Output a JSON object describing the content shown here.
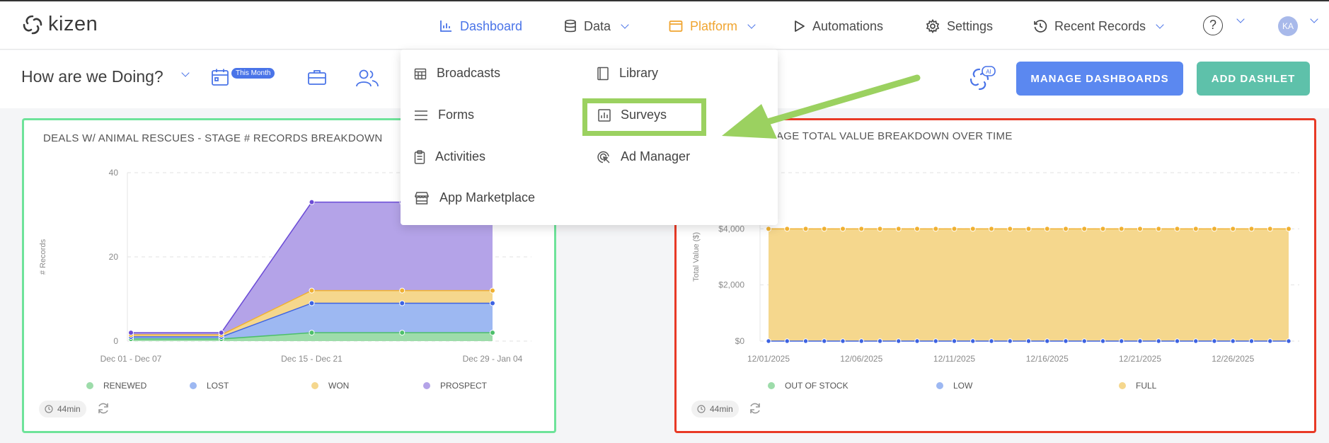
{
  "topbar": {
    "logo_text": "kizen",
    "nav": {
      "dashboard": "Dashboard",
      "data": "Data",
      "platform": "Platform",
      "automations": "Automations",
      "settings": "Settings",
      "recent_records": "Recent Records"
    },
    "help": "?",
    "avatar": "KA"
  },
  "subbar": {
    "title": "How are we Doing?",
    "badge": "This Month",
    "manage_label": "MANAGE DASHBOARDS",
    "add_label": "ADD DASHLET",
    "ai_label": "AI"
  },
  "dropdown": {
    "broadcasts": "Broadcasts",
    "forms": "Forms",
    "activities": "Activities",
    "app_marketplace": "App Marketplace",
    "library": "Library",
    "surveys": "Surveys",
    "ad_manager": "Ad Manager"
  },
  "left_card": {
    "title": "DEALS W/ ANIMAL RESCUES - STAGE # RECORDS BREAKDOWN",
    "refresh_age": "44min"
  },
  "right_card": {
    "title": "AGE TOTAL VALUE BREAKDOWN OVER TIME",
    "refresh_age": "44min"
  },
  "chart_data": [
    {
      "type": "area",
      "title": "DEALS W/ ANIMAL RESCUES - STAGE # RECORDS BREAKDOWN",
      "ylabel": "# Records",
      "ylim": [
        0,
        40
      ],
      "y_ticks": [
        "0",
        "20",
        "40"
      ],
      "x_tick_labels": [
        "Dec 01 - Dec 07",
        "Dec 15 - Dec 21",
        "Dec 29 - Jan 04"
      ],
      "x": [
        "Dec 01 - Dec 07",
        "Dec 08 - Dec 14",
        "Dec 15 - Dec 21",
        "Dec 22 - Dec 28",
        "Dec 29 - Jan 04"
      ],
      "stacked": true,
      "series": [
        {
          "name": "RENEWED",
          "color": "#9ddcaa",
          "values": [
            0.5,
            0.5,
            2,
            2,
            2
          ]
        },
        {
          "name": "LOST",
          "color": "#9db8f2",
          "values": [
            0.5,
            0.5,
            7,
            7,
            7
          ]
        },
        {
          "name": "WON",
          "color": "#f5d78d",
          "values": [
            0.5,
            0.5,
            3,
            3,
            3
          ]
        },
        {
          "name": "PROSPECT",
          "color": "#b4a3e8",
          "values": [
            0.5,
            0.5,
            21,
            21,
            21
          ]
        }
      ],
      "legend_position": "bottom"
    },
    {
      "type": "area",
      "title": "AGE TOTAL VALUE BREAKDOWN OVER TIME",
      "ylabel": "Total Value ($)",
      "y_ticks": [
        "$0",
        "$2,000",
        "$4,000"
      ],
      "ylim": [
        0,
        6000
      ],
      "x_tick_labels": [
        "12/01/2025",
        "12/06/2025",
        "12/11/2025",
        "12/16/2025",
        "12/21/2025",
        "12/26/2025"
      ],
      "x": [
        "12/01/2025",
        "12/02/2025",
        "12/03/2025",
        "12/04/2025",
        "12/05/2025",
        "12/06/2025",
        "12/07/2025",
        "12/08/2025",
        "12/09/2025",
        "12/10/2025",
        "12/11/2025",
        "12/12/2025",
        "12/13/2025",
        "12/14/2025",
        "12/15/2025",
        "12/16/2025",
        "12/17/2025",
        "12/18/2025",
        "12/19/2025",
        "12/20/2025",
        "12/21/2025",
        "12/22/2025",
        "12/23/2025",
        "12/24/2025",
        "12/25/2025",
        "12/26/2025",
        "12/27/2025",
        "12/28/2025",
        "12/29/2025"
      ],
      "series": [
        {
          "name": "OUT OF STOCK",
          "color": "#9ddcaa",
          "values": [
            0,
            0,
            0,
            0,
            0,
            0,
            0,
            0,
            0,
            0,
            0,
            0,
            0,
            0,
            0,
            0,
            0,
            0,
            0,
            0,
            0,
            0,
            0,
            0,
            0,
            0,
            0,
            0,
            0
          ]
        },
        {
          "name": "LOW",
          "color": "#9db8f2",
          "values": [
            0,
            0,
            0,
            0,
            0,
            0,
            0,
            0,
            0,
            0,
            0,
            0,
            0,
            0,
            0,
            0,
            0,
            0,
            0,
            0,
            0,
            0,
            0,
            0,
            0,
            0,
            0,
            0,
            0
          ]
        },
        {
          "name": "FULL",
          "color": "#f5d78d",
          "values": [
            4000,
            4000,
            4000,
            4000,
            4000,
            4000,
            4000,
            4000,
            4000,
            4000,
            4000,
            4000,
            4000,
            4000,
            4000,
            4000,
            4000,
            4000,
            4000,
            4000,
            4000,
            4000,
            4000,
            4000,
            4000,
            4000,
            4000,
            4000,
            4000
          ]
        }
      ],
      "legend_position": "bottom"
    }
  ]
}
